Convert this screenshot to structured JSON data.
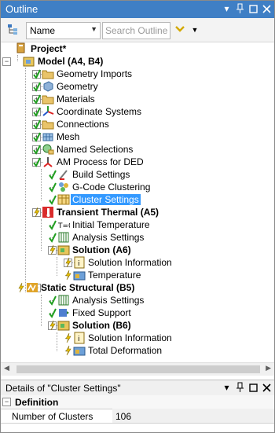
{
  "panel": {
    "title": "Outline",
    "icons": [
      "dropdown-icon",
      "pin-icon",
      "maximize-icon",
      "close-icon"
    ]
  },
  "toolbar": {
    "name_select": "Name",
    "search_placeholder": "Search Outline"
  },
  "tree": [
    {
      "label": "Project*",
      "bold": true
    },
    {
      "label": "Model (A4, B4)",
      "bold": true
    },
    {
      "label": "Geometry Imports"
    },
    {
      "label": "Geometry"
    },
    {
      "label": "Materials"
    },
    {
      "label": "Coordinate Systems"
    },
    {
      "label": "Connections"
    },
    {
      "label": "Mesh"
    },
    {
      "label": "Named Selections"
    },
    {
      "label": "AM Process for DED"
    },
    {
      "label": "Build Settings"
    },
    {
      "label": "G-Code Clustering"
    },
    {
      "label": "Cluster Settings",
      "selected": true
    },
    {
      "label": "Transient Thermal (A5)",
      "bold": true
    },
    {
      "label": "Initial Temperature"
    },
    {
      "label": "Analysis Settings"
    },
    {
      "label": "Solution (A6)",
      "bold": true
    },
    {
      "label": "Solution Information"
    },
    {
      "label": "Temperature"
    },
    {
      "label": "Static Structural (B5)",
      "bold": true
    },
    {
      "label": "Analysis Settings"
    },
    {
      "label": "Fixed Support"
    },
    {
      "label": "Solution (B6)",
      "bold": true
    },
    {
      "label": "Solution Information"
    },
    {
      "label": "Total Deformation"
    }
  ],
  "details": {
    "title": "Details of \"Cluster Settings\"",
    "group": "Definition",
    "prop_label": "Number of Clusters",
    "prop_value": "106"
  },
  "colors": {
    "titlebar": "#3f7fc5",
    "selection": "#3399ff",
    "check_green": "#1f9e1f",
    "bolt_yellow": "#e8c000"
  }
}
